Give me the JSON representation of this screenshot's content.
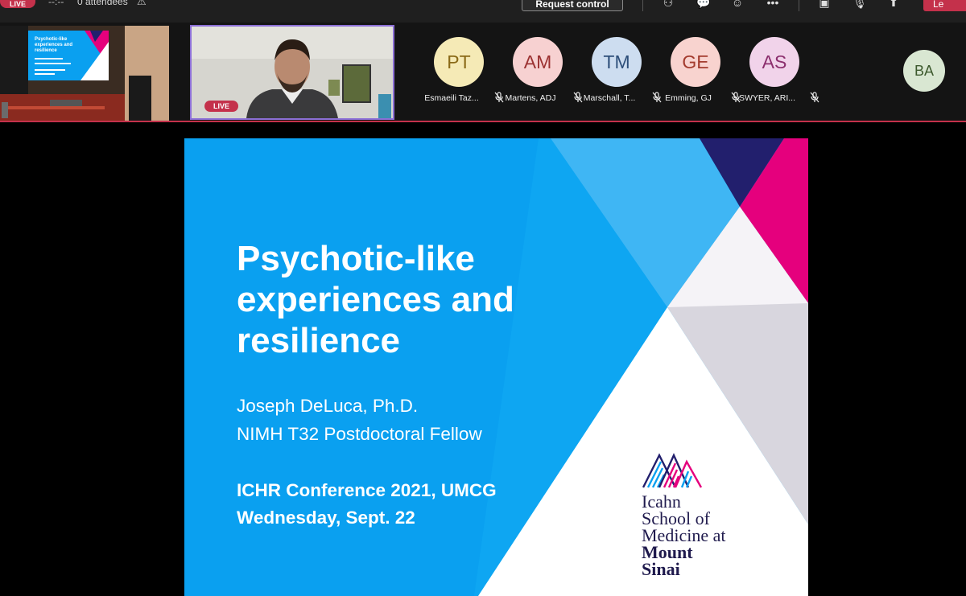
{
  "topbar": {
    "live_label": "LIVE",
    "timer": "--:--",
    "attendees": "0 attendees",
    "request_control_label": "Request control",
    "icons": [
      "warning-icon",
      "share-icon",
      "chat-icon",
      "reactions-icon",
      "more-icon",
      "camera-off-icon",
      "mic-off-icon",
      "share-tray-icon"
    ],
    "leave_label": "Le"
  },
  "presenter": {
    "live_label": "LIVE"
  },
  "participants": [
    {
      "initials": "PT",
      "name": "Esmaeili Taz...",
      "avatar_bg": "#f5eab6",
      "avatar_fg": "#8a6a18"
    },
    {
      "initials": "AM",
      "name": "Martens, ADJ",
      "avatar_bg": "#f7d1d1",
      "avatar_fg": "#9c3232"
    },
    {
      "initials": "TM",
      "name": "Marschall, T...",
      "avatar_bg": "#cdddf0",
      "avatar_fg": "#2e4f7a"
    },
    {
      "initials": "GE",
      "name": "Emming, GJ",
      "avatar_bg": "#f8d3cf",
      "avatar_fg": "#a33b2e"
    },
    {
      "initials": "AS",
      "name": "SWYER, ARI...",
      "avatar_bg": "#f1d3ea",
      "avatar_fg": "#8c2f6e"
    },
    {
      "initials": "BA",
      "name": "",
      "avatar_bg": "#d9e7d2",
      "avatar_fg": "#3d5a2e"
    }
  ],
  "slide": {
    "title_lines": [
      "Psychotic-like",
      "experiences and",
      "resilience"
    ],
    "author": "Joseph DeLuca, Ph.D.",
    "position": "NIMH T32 Postdoctoral Fellow",
    "conference": "ICHR Conference 2021, UMCG",
    "date": "Wednesday, Sept. 22",
    "logo_lines": [
      "Icahn",
      "School of",
      "Medicine at",
      "Mount",
      "Sinai"
    ]
  },
  "thumb_slide": {
    "title": "Psychotic-like experiences and resilience"
  },
  "colors": {
    "slide_blue": "#0aa0f0",
    "magenta": "#e5007d",
    "navy": "#221f6d",
    "live_red": "#c4314b"
  }
}
